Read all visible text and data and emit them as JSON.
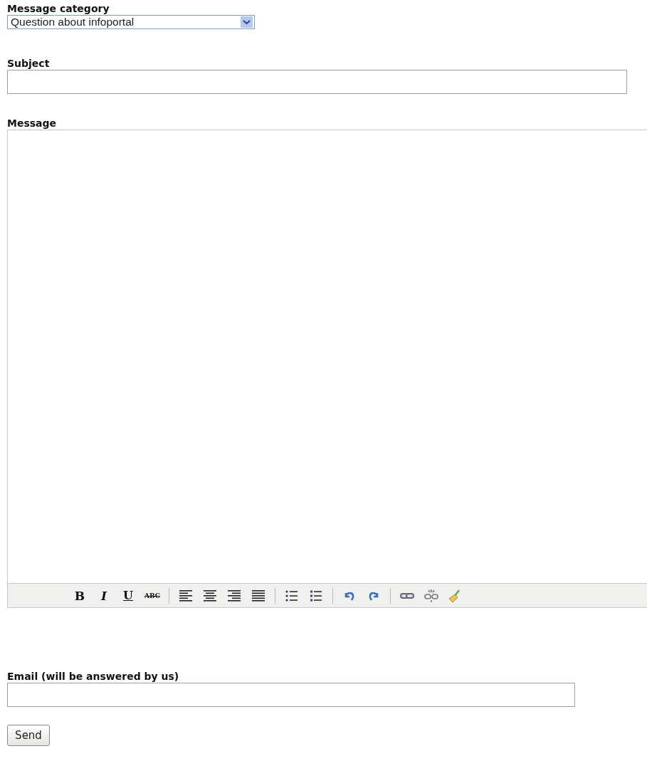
{
  "category": {
    "label": "Message category",
    "value": "Question about infoportal"
  },
  "subject": {
    "label": "Subject"
  },
  "message": {
    "label": "Message",
    "toolbar": [
      [
        {
          "kind": "bold",
          "label": "B"
        },
        {
          "kind": "italic",
          "label": "I"
        },
        {
          "kind": "underline",
          "label": "U"
        },
        {
          "kind": "strike",
          "label": "ABC"
        }
      ],
      [
        {
          "kind": "align-left"
        },
        {
          "kind": "align-center"
        },
        {
          "kind": "align-right"
        },
        {
          "kind": "justify"
        }
      ],
      [
        {
          "kind": "bullets"
        },
        {
          "kind": "numbers"
        }
      ],
      [
        {
          "kind": "undo"
        },
        {
          "kind": "redo"
        }
      ],
      [
        {
          "kind": "link"
        },
        {
          "kind": "unlink"
        },
        {
          "kind": "cleanup"
        }
      ]
    ]
  },
  "email": {
    "label": "Email (will be answered by us)"
  },
  "send": {
    "label": "Send"
  }
}
